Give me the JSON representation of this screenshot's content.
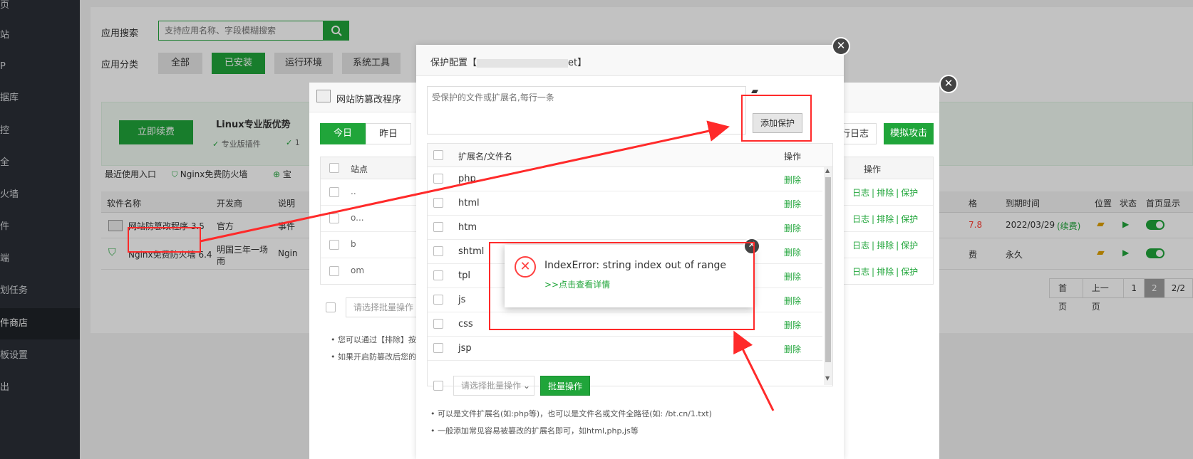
{
  "sidebar": {
    "items": [
      "页",
      "站",
      "P",
      "据库",
      "控",
      "全",
      "火墙",
      "件",
      "端",
      "划任务",
      "件商店",
      "板设置",
      "出"
    ]
  },
  "search": {
    "label": "应用搜索",
    "placeholder": "支持应用名称、字段模糊搜索"
  },
  "category": {
    "label": "应用分类",
    "tabs": [
      "全部",
      "已安装",
      "运行环境",
      "系统工具"
    ]
  },
  "promo": {
    "renew_button": "立即续费",
    "title": "Linux专业版优势",
    "feature1": "专业版插件",
    "feature2": "1"
  },
  "recent": {
    "label": "最近使用入口",
    "item1": "Nginx免费防火墙",
    "item2": "宝"
  },
  "software_table": {
    "headers": [
      "软件名称",
      "开发商",
      "说明"
    ],
    "rows": [
      {
        "name": "网站防篡改程序 3.5",
        "dev": "官方",
        "desc": "事件"
      },
      {
        "name": "Nginx免费防火墙 6.4",
        "dev": "明国三年一场雨",
        "desc": "Ngin"
      }
    ]
  },
  "right_table": {
    "headers": [
      "格",
      "到期时间",
      "位置",
      "状态",
      "首页显示"
    ],
    "rows": [
      {
        "price": "7.8",
        "expire": "2022/03/29",
        "renew": "(续费)"
      },
      {
        "price": "费",
        "expire": "永久",
        "renew": ""
      }
    ]
  },
  "pagination": {
    "items": [
      "首页",
      "上一页",
      "1",
      "2",
      "2/2"
    ]
  },
  "tamper_dialog": {
    "title": "网站防篡改程序",
    "tabs": [
      "今日",
      "昨日"
    ],
    "col_site": "站点",
    "col_ops": "操作",
    "buttons": [
      "运行日志",
      "模拟攻击"
    ],
    "rows": [
      "..",
      "o...",
      "b",
      "om"
    ],
    "ops": {
      "log": "日志",
      "exclude": "排除",
      "protect": "保护"
    },
    "batch_placeholder": "请选择批量操作",
    "notes": [
      "您可以通过【排除】按",
      "如果开启防篡改后您的"
    ]
  },
  "protect_dialog": {
    "title": "保护配置【",
    "title_suffix": "et】",
    "textarea_placeholder": "受保护的文件或扩展名,每行一条",
    "add_button": "添加保护",
    "col_name": "扩展名/文件名",
    "col_ops": "操作",
    "rows": [
      "php",
      "html",
      "htm",
      "shtml",
      "tpl",
      "js",
      "css",
      "jsp"
    ],
    "delete_label": "删除",
    "batch_placeholder": "请选择批量操作",
    "batch_button": "批量操作",
    "notes": [
      "可以是文件扩展名(如:php等)，也可以是文件名或文件全路径(如: /bt.cn/1.txt)",
      "一般添加常见容易被篡改的扩展名即可，如html,php,js等"
    ]
  },
  "error_popup": {
    "message": "IndexError: string index out of range",
    "link": ">>点击查看详情"
  },
  "colors": {
    "brand_green": "#20a53a",
    "annotation_red": "#ff2a2a",
    "sidebar_bg": "#2b2f36"
  }
}
